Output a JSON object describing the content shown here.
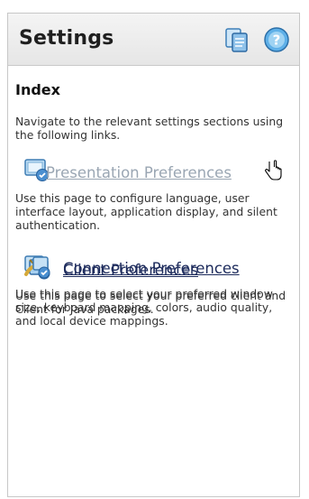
{
  "panel": {
    "title": "Settings",
    "header_icons": [
      {
        "name": "copy-pages-icon"
      },
      {
        "name": "help-icon"
      }
    ]
  },
  "index": {
    "heading": "Index",
    "intro": "Navigate to the relevant settings sections using the following links."
  },
  "sections": [
    {
      "link": "Presentation Preferences",
      "description": "Use this page to configure language, user interface layout, application display, and silent authentication.",
      "state": "hovered"
    },
    {
      "link": "Client Preferences",
      "description": "Use this page to select your preferred client and Client for Java packages."
    },
    {
      "link": "Connection Preferences",
      "description": "Use this page to select your preferred window size, keyboard mapping, colors, audio quality, and local device mappings."
    }
  ],
  "colors": {
    "link": "#1d2b5c",
    "link_hover": "#9aa6b3",
    "header_bg": "#ececec",
    "border": "#c7c7c7"
  }
}
